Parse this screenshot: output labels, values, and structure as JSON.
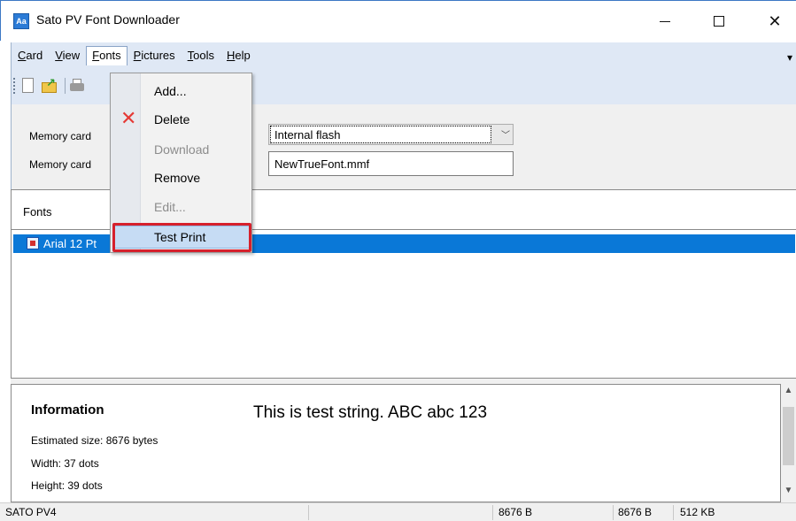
{
  "window": {
    "title": "Sato PV Font Downloader",
    "icon_text": "Aa",
    "controls": {
      "minimize": "minimize-icon",
      "maximize": "maximize-icon",
      "close": "close-icon"
    },
    "close_glyph": "✕"
  },
  "menubar": {
    "items": [
      {
        "label": "Card",
        "accel": "C",
        "rest": "ard"
      },
      {
        "label": "View",
        "accel": "V",
        "rest": "iew"
      },
      {
        "label": "Fonts",
        "accel": "F",
        "rest": "onts",
        "active": true
      },
      {
        "label": "Pictures",
        "accel": "P",
        "rest": "ictures"
      },
      {
        "label": "Tools",
        "accel": "T",
        "rest": "ools"
      },
      {
        "label": "Help",
        "accel": "H",
        "rest": "elp"
      }
    ],
    "overflow_glyph": "▾"
  },
  "toolbar": {
    "icons": [
      "new-file-icon",
      "open-folder-icon",
      "printer-icon"
    ]
  },
  "form": {
    "memory_card_type_label": "Memory card",
    "memory_card_name_label": "Memory card",
    "memory_type_value": "Internal flash",
    "file_name_value": "NewTrueFont.mmf"
  },
  "fonts_pane": {
    "header": "Fonts",
    "rows": [
      {
        "label": "Arial 12 Pt",
        "visible_text": "Arial 12 Pt",
        "selected": true
      }
    ]
  },
  "fonts_menu": {
    "items": [
      {
        "label": "Add...",
        "enabled": true
      },
      {
        "label": "Delete",
        "enabled": true,
        "icon": "red-x-icon"
      },
      {
        "label": "Download",
        "enabled": false
      },
      {
        "label": "Remove",
        "enabled": true
      },
      {
        "label": "Edit...",
        "enabled": false
      },
      {
        "label": "Test Print",
        "enabled": true,
        "highlighted": true
      }
    ]
  },
  "info_pane": {
    "title": "Information",
    "estimated_size": "Estimated size: 8676 bytes",
    "width": "Width: 37 dots",
    "height": "Height: 39 dots",
    "sample_text": "This is test string. ABC abc 123"
  },
  "statusbar": {
    "printer": "SATO PV4",
    "cell2": "",
    "size1": "8676 B",
    "size2": "8676 B",
    "capacity": "512 KB"
  },
  "colors": {
    "selection": "#0a78d7",
    "menu_highlight": "#c6dcf4",
    "annotation_outline": "#d6202c",
    "menu_area": "#dfe8f5"
  }
}
